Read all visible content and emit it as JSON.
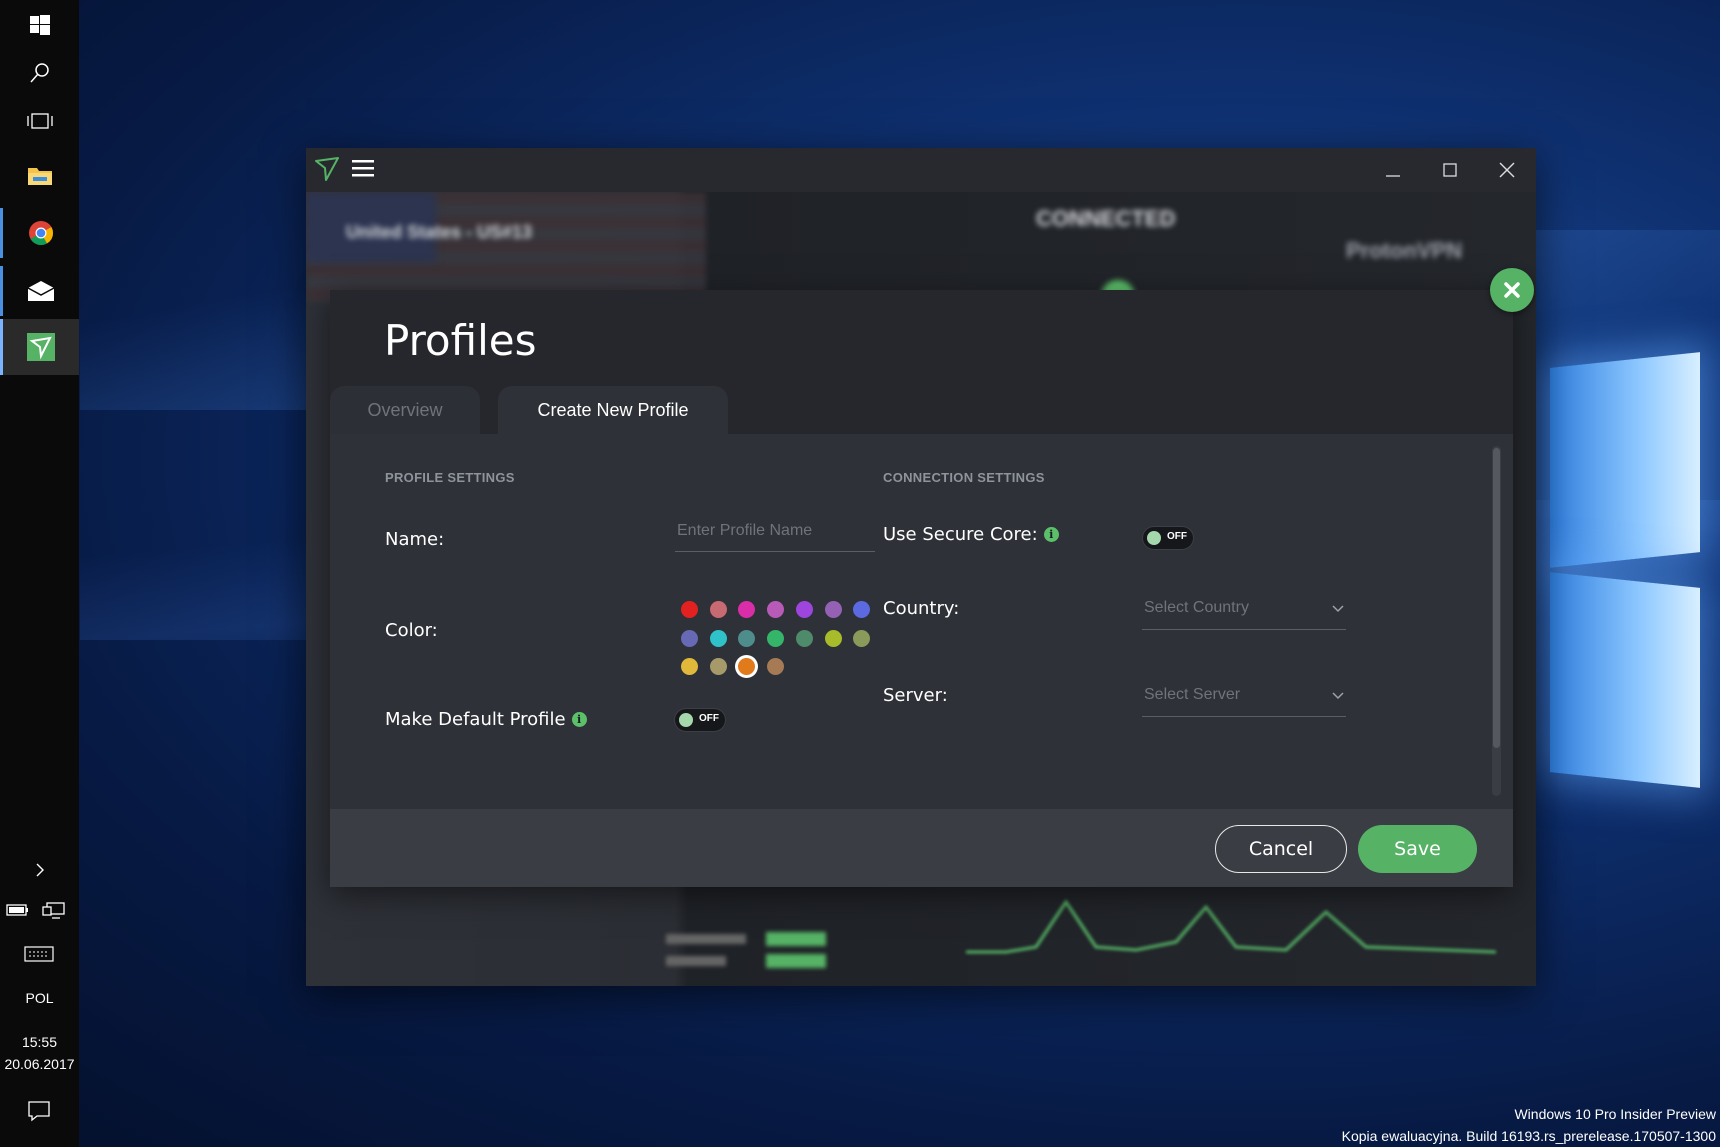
{
  "taskbar": {
    "language": "POL",
    "time": "15:55",
    "date": "20.06.2017",
    "items": [
      "windows-icon",
      "search-icon",
      "task-view-icon",
      "file-explorer-icon",
      "chrome-icon",
      "mail-icon",
      "protonvpn-icon"
    ]
  },
  "colors": {
    "accent": "#56b366",
    "panel": "#2e3137",
    "modal": "#25272c"
  },
  "modal": {
    "title": "Profiles",
    "tabs": [
      "Overview",
      "Create New Profile"
    ],
    "active_tab": "Create New Profile",
    "profile_settings": {
      "heading": "PROFILE SETTINGS",
      "name_label": "Name:",
      "name_placeholder": "Enter Profile Name",
      "name_value": "",
      "color_label": "Color:",
      "colors": [
        "#e42121",
        "#c86a72",
        "#d92ea8",
        "#b85bb8",
        "#9d45dc",
        "#9461b5",
        "#5b6ae0",
        "#6769b4",
        "#2fc2c9",
        "#4f8c8c",
        "#34b56a",
        "#4f8a6a",
        "#a8bb2a",
        "#8a9a5a",
        "#e0b83a",
        "#a69a6a",
        "#e07a1a",
        "#a57a55"
      ],
      "selected_color": "#e07a1a",
      "default_label": "Make Default Profile",
      "default_toggle": "OFF"
    },
    "connection_settings": {
      "heading": "CONNECTION SETTINGS",
      "secure_core_label": "Use Secure Core:",
      "secure_core_toggle": "OFF",
      "country_label": "Country:",
      "country_placeholder": "Select Country",
      "server_label": "Server:",
      "server_placeholder": "Select Server"
    },
    "cancel_label": "Cancel",
    "save_label": "Save"
  },
  "background_app": {
    "status": "CONNECTED",
    "server": "United States - US#13",
    "brand": "ProtonVPN"
  },
  "watermark": {
    "line1": "Windows 10 Pro Insider Preview",
    "line2": "Kopia ewaluacyjna. Build 16193.rs_prerelease.170507-1300"
  }
}
